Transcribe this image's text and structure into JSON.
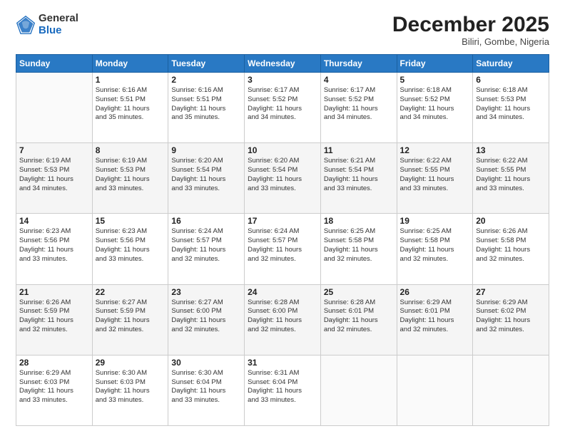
{
  "logo": {
    "general": "General",
    "blue": "Blue"
  },
  "header": {
    "month": "December 2025",
    "location": "Biliri, Gombe, Nigeria"
  },
  "weekdays": [
    "Sunday",
    "Monday",
    "Tuesday",
    "Wednesday",
    "Thursday",
    "Friday",
    "Saturday"
  ],
  "weeks": [
    [
      {
        "day": "",
        "text": ""
      },
      {
        "day": "1",
        "text": "Sunrise: 6:16 AM\nSunset: 5:51 PM\nDaylight: 11 hours\nand 35 minutes."
      },
      {
        "day": "2",
        "text": "Sunrise: 6:16 AM\nSunset: 5:51 PM\nDaylight: 11 hours\nand 35 minutes."
      },
      {
        "day": "3",
        "text": "Sunrise: 6:17 AM\nSunset: 5:52 PM\nDaylight: 11 hours\nand 34 minutes."
      },
      {
        "day": "4",
        "text": "Sunrise: 6:17 AM\nSunset: 5:52 PM\nDaylight: 11 hours\nand 34 minutes."
      },
      {
        "day": "5",
        "text": "Sunrise: 6:18 AM\nSunset: 5:52 PM\nDaylight: 11 hours\nand 34 minutes."
      },
      {
        "day": "6",
        "text": "Sunrise: 6:18 AM\nSunset: 5:53 PM\nDaylight: 11 hours\nand 34 minutes."
      }
    ],
    [
      {
        "day": "7",
        "text": "Sunrise: 6:19 AM\nSunset: 5:53 PM\nDaylight: 11 hours\nand 34 minutes."
      },
      {
        "day": "8",
        "text": "Sunrise: 6:19 AM\nSunset: 5:53 PM\nDaylight: 11 hours\nand 33 minutes."
      },
      {
        "day": "9",
        "text": "Sunrise: 6:20 AM\nSunset: 5:54 PM\nDaylight: 11 hours\nand 33 minutes."
      },
      {
        "day": "10",
        "text": "Sunrise: 6:20 AM\nSunset: 5:54 PM\nDaylight: 11 hours\nand 33 minutes."
      },
      {
        "day": "11",
        "text": "Sunrise: 6:21 AM\nSunset: 5:54 PM\nDaylight: 11 hours\nand 33 minutes."
      },
      {
        "day": "12",
        "text": "Sunrise: 6:22 AM\nSunset: 5:55 PM\nDaylight: 11 hours\nand 33 minutes."
      },
      {
        "day": "13",
        "text": "Sunrise: 6:22 AM\nSunset: 5:55 PM\nDaylight: 11 hours\nand 33 minutes."
      }
    ],
    [
      {
        "day": "14",
        "text": "Sunrise: 6:23 AM\nSunset: 5:56 PM\nDaylight: 11 hours\nand 33 minutes."
      },
      {
        "day": "15",
        "text": "Sunrise: 6:23 AM\nSunset: 5:56 PM\nDaylight: 11 hours\nand 33 minutes."
      },
      {
        "day": "16",
        "text": "Sunrise: 6:24 AM\nSunset: 5:57 PM\nDaylight: 11 hours\nand 32 minutes."
      },
      {
        "day": "17",
        "text": "Sunrise: 6:24 AM\nSunset: 5:57 PM\nDaylight: 11 hours\nand 32 minutes."
      },
      {
        "day": "18",
        "text": "Sunrise: 6:25 AM\nSunset: 5:58 PM\nDaylight: 11 hours\nand 32 minutes."
      },
      {
        "day": "19",
        "text": "Sunrise: 6:25 AM\nSunset: 5:58 PM\nDaylight: 11 hours\nand 32 minutes."
      },
      {
        "day": "20",
        "text": "Sunrise: 6:26 AM\nSunset: 5:58 PM\nDaylight: 11 hours\nand 32 minutes."
      }
    ],
    [
      {
        "day": "21",
        "text": "Sunrise: 6:26 AM\nSunset: 5:59 PM\nDaylight: 11 hours\nand 32 minutes."
      },
      {
        "day": "22",
        "text": "Sunrise: 6:27 AM\nSunset: 5:59 PM\nDaylight: 11 hours\nand 32 minutes."
      },
      {
        "day": "23",
        "text": "Sunrise: 6:27 AM\nSunset: 6:00 PM\nDaylight: 11 hours\nand 32 minutes."
      },
      {
        "day": "24",
        "text": "Sunrise: 6:28 AM\nSunset: 6:00 PM\nDaylight: 11 hours\nand 32 minutes."
      },
      {
        "day": "25",
        "text": "Sunrise: 6:28 AM\nSunset: 6:01 PM\nDaylight: 11 hours\nand 32 minutes."
      },
      {
        "day": "26",
        "text": "Sunrise: 6:29 AM\nSunset: 6:01 PM\nDaylight: 11 hours\nand 32 minutes."
      },
      {
        "day": "27",
        "text": "Sunrise: 6:29 AM\nSunset: 6:02 PM\nDaylight: 11 hours\nand 32 minutes."
      }
    ],
    [
      {
        "day": "28",
        "text": "Sunrise: 6:29 AM\nSunset: 6:03 PM\nDaylight: 11 hours\nand 33 minutes."
      },
      {
        "day": "29",
        "text": "Sunrise: 6:30 AM\nSunset: 6:03 PM\nDaylight: 11 hours\nand 33 minutes."
      },
      {
        "day": "30",
        "text": "Sunrise: 6:30 AM\nSunset: 6:04 PM\nDaylight: 11 hours\nand 33 minutes."
      },
      {
        "day": "31",
        "text": "Sunrise: 6:31 AM\nSunset: 6:04 PM\nDaylight: 11 hours\nand 33 minutes."
      },
      {
        "day": "",
        "text": ""
      },
      {
        "day": "",
        "text": ""
      },
      {
        "day": "",
        "text": ""
      }
    ]
  ]
}
